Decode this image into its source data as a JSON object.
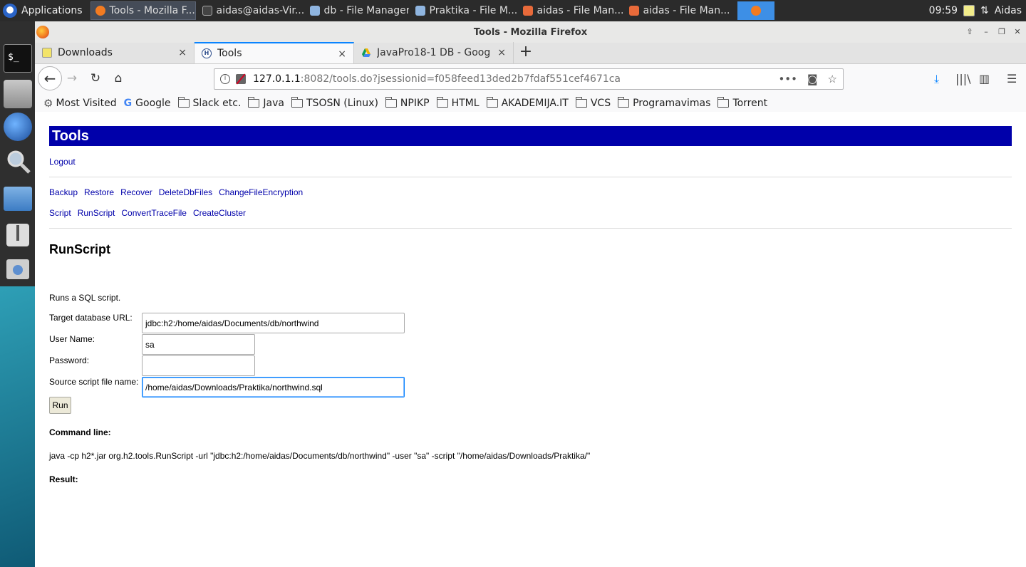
{
  "panel": {
    "applications_label": "Applications",
    "tasks": [
      {
        "label": "Tools - Mozilla F...",
        "active": true,
        "color": "#f27b21"
      },
      {
        "label": "aidas@aidas-Vir...",
        "active": false,
        "color": "#444444"
      },
      {
        "label": "db - File Manager",
        "active": false,
        "color": "#8fb5e0"
      },
      {
        "label": "Praktika - File M...",
        "active": false,
        "color": "#8fb5e0"
      },
      {
        "label": "aidas - File Man...",
        "active": false,
        "color": "#e86a3a"
      },
      {
        "label": "aidas - File Man...",
        "active": false,
        "color": "#e86a3a"
      }
    ],
    "clock": "09:59",
    "user": "Aidas"
  },
  "window": {
    "title": "Tools - Mozilla Firefox"
  },
  "tabs": [
    {
      "label": "Downloads",
      "selected": false,
      "close": "×"
    },
    {
      "label": "Tools",
      "selected": true,
      "close": "×"
    },
    {
      "label": "JavaPro18-1 DB - Google",
      "selected": false,
      "close": "×"
    }
  ],
  "newtab_label": "+",
  "urlbar": {
    "host": "127.0.1.1",
    "rest": ":8082/tools.do?jsessionid=f058feed13ded2b7fdaf551cef4671ca"
  },
  "bookmarks": [
    {
      "label": "Most Visited",
      "icon": "gear-icon"
    },
    {
      "label": "Google",
      "icon": "google-icon"
    },
    {
      "label": "Slack etc.",
      "icon": "folder-icon"
    },
    {
      "label": "Java",
      "icon": "folder-icon"
    },
    {
      "label": "TSOSN (Linux)",
      "icon": "folder-icon"
    },
    {
      "label": "NPIKP",
      "icon": "folder-icon"
    },
    {
      "label": "HTML",
      "icon": "folder-icon"
    },
    {
      "label": "AKADEMIJA.IT",
      "icon": "folder-icon"
    },
    {
      "label": "VCS",
      "icon": "folder-icon"
    },
    {
      "label": "Programavimas",
      "icon": "folder-icon"
    },
    {
      "label": "Torrent",
      "icon": "folder-icon"
    }
  ],
  "page": {
    "header_title": "Tools",
    "logout": "Logout",
    "links_row1": [
      "Backup",
      "Restore",
      "Recover",
      "DeleteDbFiles",
      "ChangeFileEncryption"
    ],
    "links_row2": [
      "Script",
      "RunScript",
      "ConvertTraceFile",
      "CreateCluster"
    ],
    "section_title": "RunScript",
    "description": "Runs a SQL script.",
    "form": {
      "url_label": "Target database URL:",
      "url_value": "jdbc:h2:/home/aidas/Documents/db/northwind",
      "user_label": "User Name:",
      "user_value": "sa",
      "password_label": "Password:",
      "password_value": "",
      "script_label": "Source script file name:",
      "script_value": "/home/aidas/Downloads/Praktika/northwind.sql"
    },
    "run_button": "Run",
    "command_line_label": "Command line:",
    "command_line": "java -cp h2*.jar org.h2.tools.RunScript -url \"jdbc:h2:/home/aidas/Documents/db/northwind\" -user \"sa\" -script \"/home/aidas/Downloads/Praktika/\"",
    "result_label": "Result:"
  },
  "colors": {
    "header_bg": "#0000aa",
    "link": "#0000aa",
    "tab_accent": "#0a84ff"
  }
}
